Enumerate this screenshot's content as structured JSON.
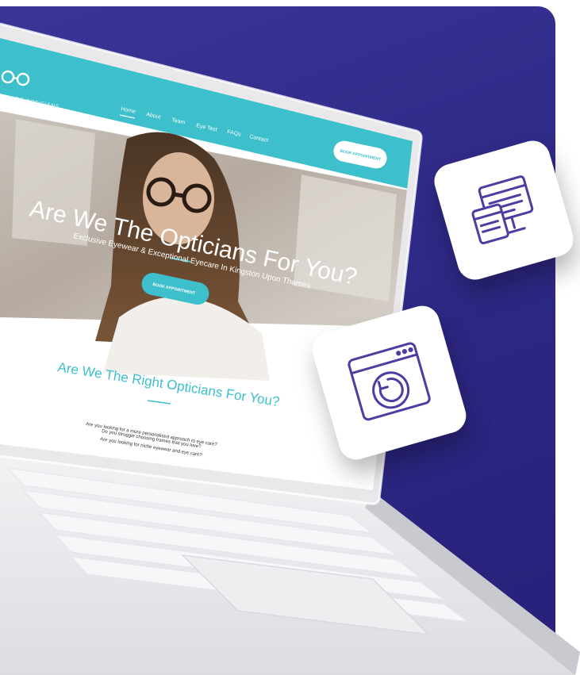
{
  "brand": {
    "logo_name": "glasses-logo",
    "name": "CARE OPTICIANS"
  },
  "nav": {
    "items": [
      {
        "label": "Home"
      },
      {
        "label": "About"
      },
      {
        "label": "Team"
      },
      {
        "label": "Eye Test"
      },
      {
        "label": "FAQs"
      },
      {
        "label": "Contact"
      }
    ],
    "book_button": "BOOK APPOINTMENT"
  },
  "hero": {
    "title": "Are We The Opticians For You?",
    "subtitle": "Exclusive Eyewear & Exceptional Eyecare In Kingston Upon Thames",
    "cta": "BOOK APPOINTMENT"
  },
  "section": {
    "heading": "Are We The Right Opticians For You?",
    "lines": [
      "Are you looking for a more personalised approach to eye care?",
      "Do you struggle choosing frames that you love?",
      "Are you looking for niche eyewear and eye care?"
    ]
  },
  "colors": {
    "accent": "#3dbfcc",
    "panel": "#2f2a87",
    "icon_stroke": "#4a3ea0"
  },
  "icons": {
    "tile1": "browser-and-card-icon",
    "tile2": "browser-refresh-icon"
  }
}
